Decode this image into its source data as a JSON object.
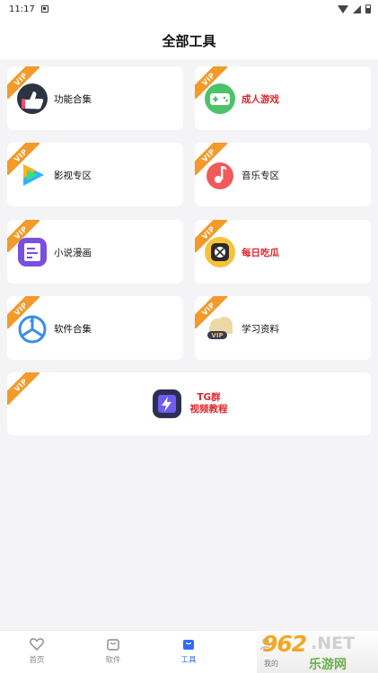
{
  "status_bar": {
    "time": "11:17"
  },
  "header": {
    "title": "全部工具"
  },
  "vip_badge": "VIP",
  "tools": [
    {
      "label": "功能合集",
      "highlight": false,
      "icon": "thumbs-up-icon"
    },
    {
      "label": "成人游戏",
      "highlight": true,
      "icon": "gamepad-icon"
    },
    {
      "label": "影视专区",
      "highlight": false,
      "icon": "video-play-icon"
    },
    {
      "label": "音乐专区",
      "highlight": false,
      "icon": "music-icon"
    },
    {
      "label": "小说漫画",
      "highlight": false,
      "icon": "book-icon"
    },
    {
      "label": "每日吃瓜",
      "highlight": true,
      "icon": "melon-icon"
    },
    {
      "label": "软件合集",
      "highlight": false,
      "icon": "software-icon"
    },
    {
      "label": "学习资料",
      "highlight": false,
      "icon": "vip-cloud-icon"
    }
  ],
  "wide_tool": {
    "line1": "TG群",
    "line2": "视频教程",
    "icon": "lightning-icon"
  },
  "tabbar": [
    {
      "label": "首页",
      "icon": "heart-icon",
      "active": false
    },
    {
      "label": "软件",
      "icon": "bag-icon",
      "active": false
    },
    {
      "label": "工具",
      "icon": "toolbox-icon",
      "active": true
    },
    {
      "label": "我的",
      "icon": "user-icon",
      "active": false
    }
  ],
  "watermark": {
    "logo": "962",
    "suffix": ".NET",
    "sub": "乐游网",
    "small": "我的"
  },
  "colors": {
    "vip": "#f39a2b",
    "highlight_text": "#e0252b",
    "active_tab": "#2f6bff"
  }
}
